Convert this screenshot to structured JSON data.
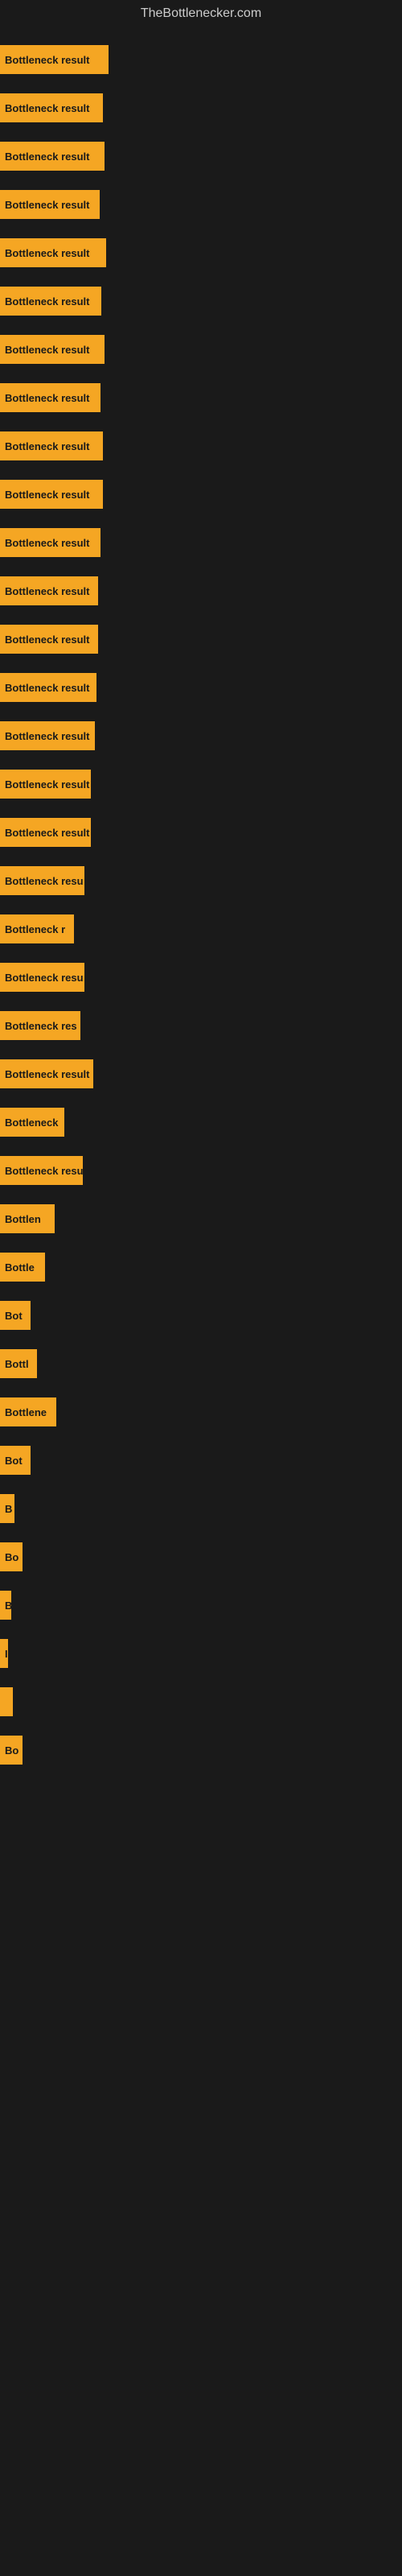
{
  "site": {
    "title": "TheBottlenecker.com"
  },
  "bars": [
    {
      "label": "Bottleneck result",
      "width": 135
    },
    {
      "label": "Bottleneck result",
      "width": 128
    },
    {
      "label": "Bottleneck result",
      "width": 130
    },
    {
      "label": "Bottleneck result",
      "width": 124
    },
    {
      "label": "Bottleneck result",
      "width": 132
    },
    {
      "label": "Bottleneck result",
      "width": 126
    },
    {
      "label": "Bottleneck result",
      "width": 130
    },
    {
      "label": "Bottleneck result",
      "width": 125
    },
    {
      "label": "Bottleneck result",
      "width": 128
    },
    {
      "label": "Bottleneck result",
      "width": 128
    },
    {
      "label": "Bottleneck result",
      "width": 125
    },
    {
      "label": "Bottleneck result",
      "width": 122
    },
    {
      "label": "Bottleneck result",
      "width": 122
    },
    {
      "label": "Bottleneck result",
      "width": 120
    },
    {
      "label": "Bottleneck result",
      "width": 118
    },
    {
      "label": "Bottleneck result",
      "width": 113
    },
    {
      "label": "Bottleneck result",
      "width": 113
    },
    {
      "label": "Bottleneck resu",
      "width": 105
    },
    {
      "label": "Bottleneck r",
      "width": 92
    },
    {
      "label": "Bottleneck resu",
      "width": 105
    },
    {
      "label": "Bottleneck res",
      "width": 100
    },
    {
      "label": "Bottleneck result",
      "width": 116
    },
    {
      "label": "Bottleneck",
      "width": 80
    },
    {
      "label": "Bottleneck resu",
      "width": 103
    },
    {
      "label": "Bottlen",
      "width": 68
    },
    {
      "label": "Bottle",
      "width": 56
    },
    {
      "label": "Bot",
      "width": 38
    },
    {
      "label": "Bottl",
      "width": 46
    },
    {
      "label": "Bottlene",
      "width": 70
    },
    {
      "label": "Bot",
      "width": 38
    },
    {
      "label": "B",
      "width": 18
    },
    {
      "label": "Bo",
      "width": 28
    },
    {
      "label": "B",
      "width": 14
    },
    {
      "label": "I",
      "width": 10
    },
    {
      "label": "",
      "width": 16
    },
    {
      "label": "Bo",
      "width": 28
    }
  ]
}
